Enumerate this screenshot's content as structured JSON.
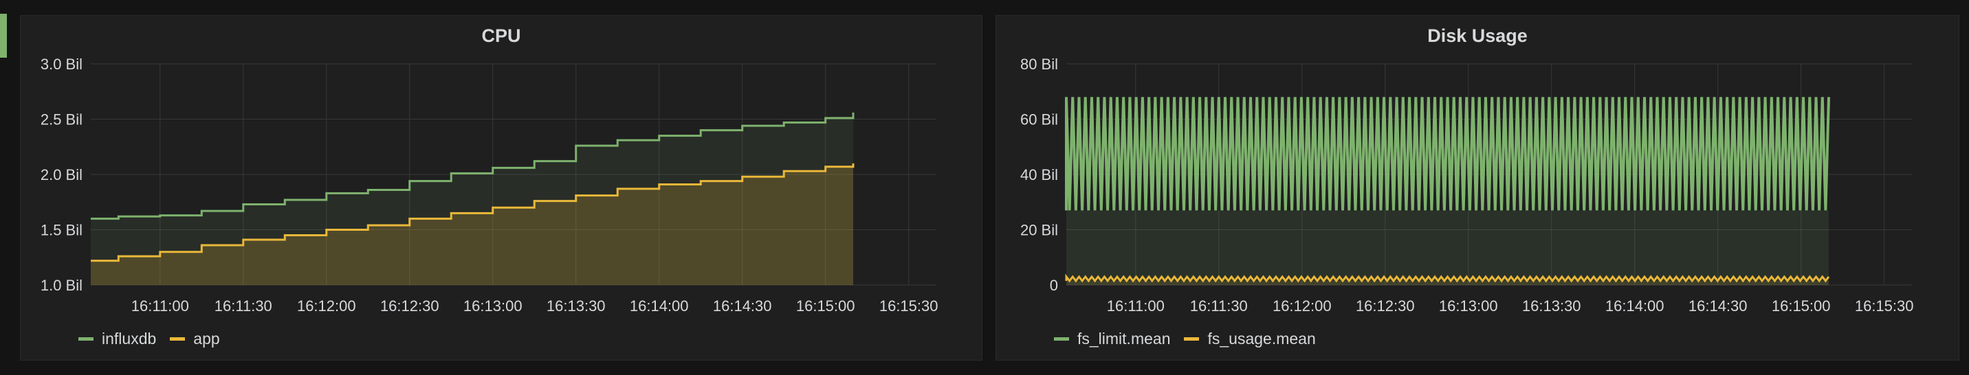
{
  "colors": {
    "accent": "#7eb26d",
    "influxdb": "#7eb26d",
    "app": "#eab839",
    "fs_limit": "#7eb26d",
    "fs_usage": "#eab839"
  },
  "chart_data": [
    {
      "title": "CPU",
      "type": "area",
      "x_ticks": [
        "16:11:00",
        "16:11:30",
        "16:12:00",
        "16:12:30",
        "16:13:00",
        "16:13:30",
        "16:14:00",
        "16:14:30",
        "16:15:00",
        "16:15:30"
      ],
      "y_ticks": [
        "1.0 Bil",
        "1.5 Bil",
        "2.0 Bil",
        "2.5 Bil",
        "3.0 Bil"
      ],
      "ylim": [
        1.0,
        3.0
      ],
      "xlim": [
        "16:10:35",
        "16:15:40"
      ],
      "grid": true,
      "legend_position": "bottom-left",
      "series": [
        {
          "name": "influxdb",
          "color": "#7eb26d",
          "x": [
            "16:10:35",
            "16:10:45",
            "16:11:00",
            "16:11:15",
            "16:11:30",
            "16:11:45",
            "16:12:00",
            "16:12:15",
            "16:12:30",
            "16:12:45",
            "16:13:00",
            "16:13:15",
            "16:13:30",
            "16:13:45",
            "16:14:00",
            "16:14:15",
            "16:14:30",
            "16:14:45",
            "16:15:00",
            "16:15:10"
          ],
          "values": [
            1.6,
            1.62,
            1.63,
            1.67,
            1.73,
            1.77,
            1.83,
            1.86,
            1.94,
            2.01,
            2.06,
            2.12,
            2.26,
            2.31,
            2.35,
            2.4,
            2.44,
            2.47,
            2.51,
            2.56
          ]
        },
        {
          "name": "app",
          "color": "#eab839",
          "x": [
            "16:10:35",
            "16:10:45",
            "16:11:00",
            "16:11:15",
            "16:11:30",
            "16:11:45",
            "16:12:00",
            "16:12:15",
            "16:12:30",
            "16:12:45",
            "16:13:00",
            "16:13:15",
            "16:13:30",
            "16:13:45",
            "16:14:00",
            "16:14:15",
            "16:14:30",
            "16:14:45",
            "16:15:00",
            "16:15:10"
          ],
          "values": [
            1.22,
            1.26,
            1.3,
            1.36,
            1.41,
            1.45,
            1.5,
            1.54,
            1.6,
            1.65,
            1.7,
            1.76,
            1.81,
            1.87,
            1.91,
            1.94,
            1.98,
            2.03,
            2.07,
            2.1
          ]
        }
      ]
    },
    {
      "title": "Disk Usage",
      "type": "area",
      "x_ticks": [
        "16:11:00",
        "16:11:30",
        "16:12:00",
        "16:12:30",
        "16:13:00",
        "16:13:30",
        "16:14:00",
        "16:14:30",
        "16:15:00",
        "16:15:30"
      ],
      "y_ticks": [
        "0",
        "20 Bil",
        "40 Bil",
        "60 Bil",
        "80 Bil"
      ],
      "ylim": [
        0,
        80
      ],
      "xlim": [
        "16:10:35",
        "16:15:40"
      ],
      "grid": true,
      "legend_position": "bottom-left",
      "series": [
        {
          "name": "fs_limit.mean",
          "color": "#7eb26d",
          "x_range": [
            "16:10:35",
            "16:15:10"
          ],
          "values": [
            27,
            68
          ],
          "note_pattern": "alternating"
        },
        {
          "name": "fs_usage.mean",
          "color": "#eab839",
          "x_range": [
            "16:10:35",
            "16:15:10"
          ],
          "values": [
            1.5,
            3.0
          ],
          "note_pattern": "alternating"
        }
      ]
    }
  ]
}
